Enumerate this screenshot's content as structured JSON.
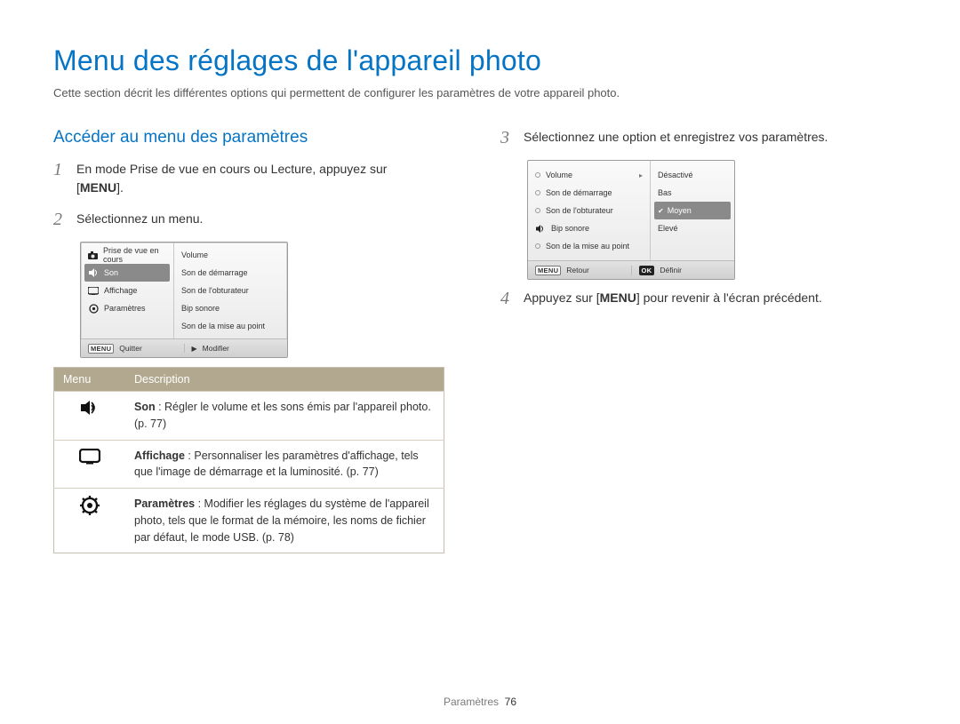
{
  "title": "Menu des réglages de l'appareil photo",
  "intro": "Cette section décrit les différentes options qui permettent de configurer les paramètres de votre appareil photo.",
  "left": {
    "heading": "Accéder au menu des paramètres",
    "steps": {
      "s1": {
        "num": "1",
        "text_a": "En mode Prise de vue en cours ou Lecture, appuyez sur",
        "text_b": "[",
        "menu_label": "MENU",
        "text_c": "]."
      },
      "s2": {
        "num": "2",
        "text": "Sélectionnez un menu."
      }
    },
    "cam": {
      "side": {
        "r0": "Prise de vue en cours",
        "r1": "Son",
        "r2": "Affichage",
        "r3": "Paramètres"
      },
      "right": {
        "r0": "Volume",
        "r1": "Son de démarrage",
        "r2": "Son de l'obturateur",
        "r3": "Bip sonore",
        "r4": "Son de la mise au point"
      },
      "foot": {
        "a_tag": "MENU",
        "a": "Quitter",
        "b_tag": "▶",
        "b": "Modifier"
      }
    },
    "table": {
      "h1": "Menu",
      "h2": "Description",
      "row1_term": "Son",
      "row1_desc": " : Régler le volume et les sons émis par l'appareil photo. (p. 77)",
      "row2_term": "Affichage",
      "row2_desc": " : Personnaliser les paramètres d'affichage, tels que l'image de démarrage et la luminosité. (p. 77)",
      "row3_term": "Paramètres",
      "row3_desc": " : Modifier les réglages du système de l'appareil photo, tels que le format de la mémoire, les noms de fichier par défaut, le mode USB. (p. 78)"
    }
  },
  "right": {
    "steps": {
      "s3": {
        "num": "3",
        "text": "Sélectionnez une option et enregistrez vos paramètres."
      },
      "s4": {
        "num": "4",
        "text_a": "Appuyez sur [",
        "menu_label": "MENU",
        "text_b": "] pour revenir à l'écran précédent."
      }
    },
    "cam": {
      "left": {
        "r0": "Volume",
        "r1": "Son de démarrage",
        "r2": "Son de l'obturateur",
        "r3": "Bip sonore",
        "r4": "Son de la mise au point"
      },
      "options": {
        "o0": "Désactivé",
        "o1": "Bas",
        "o2": "Moyen",
        "o3": "Elevé"
      },
      "foot": {
        "a_tag": "MENU",
        "a": "Retour",
        "b_tag": "OK",
        "b": "Définir"
      }
    }
  },
  "footer": {
    "section": "Paramètres",
    "page": "76"
  }
}
